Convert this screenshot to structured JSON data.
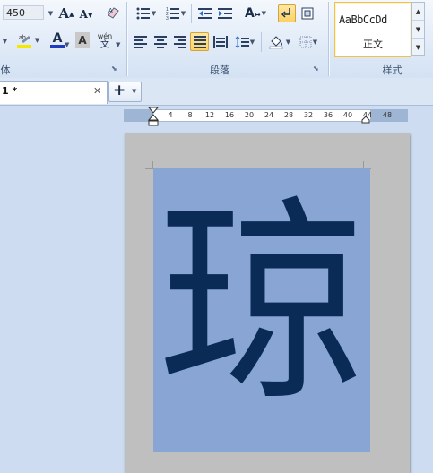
{
  "ribbon": {
    "font": {
      "size_value": "450",
      "group_label": "体",
      "grow_font_label": "A",
      "shrink_font_label": "A",
      "font_color_label": "A",
      "char_shading_label": "A",
      "phonetic_guide_label": "wén",
      "phonetic_guide_sub": "文",
      "highlight_label": "ab"
    },
    "paragraph": {
      "group_label": "段落"
    },
    "styles": {
      "sample_text": "AaBbCcDd",
      "style_name": "正文",
      "group_label": "样式"
    }
  },
  "tabs": {
    "doc_tab_label": "1 *",
    "close_label": "✕",
    "new_tab_label": "+"
  },
  "ruler": {
    "ticks": [
      "4",
      "8",
      "12",
      "16",
      "20",
      "24",
      "28",
      "32",
      "36",
      "40",
      "44",
      "48"
    ]
  },
  "document": {
    "character": "琼",
    "canvas_color": "#88a5d3",
    "text_color": "#0b2b57"
  }
}
